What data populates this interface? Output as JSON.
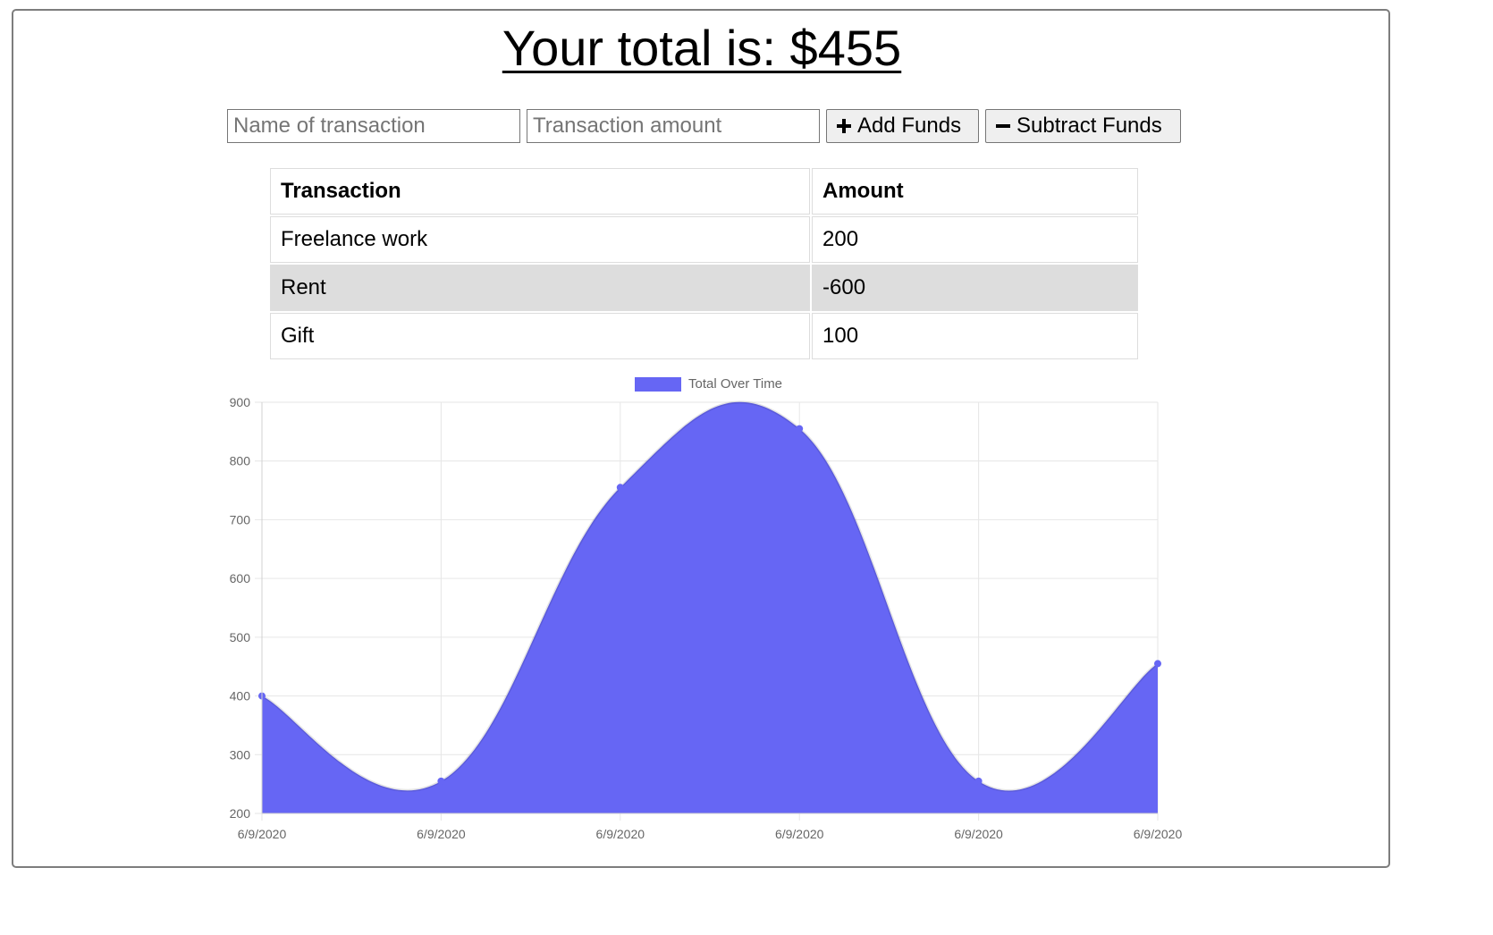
{
  "header": {
    "total_prefix": "Your total is: ",
    "total_value": "$455"
  },
  "form": {
    "name_placeholder": "Name of transaction",
    "amount_placeholder": "Transaction amount",
    "add_label": "Add Funds",
    "subtract_label": "Subtract Funds",
    "add_icon": "plus-icon",
    "subtract_icon": "minus-icon"
  },
  "table": {
    "headers": [
      "Transaction",
      "Amount"
    ],
    "rows": [
      {
        "name": "Freelance work",
        "amount": "200"
      },
      {
        "name": "Rent",
        "amount": "-600"
      },
      {
        "name": "Gift",
        "amount": "100"
      }
    ]
  },
  "chart_data": {
    "type": "area",
    "title": "",
    "xlabel": "",
    "ylabel": "",
    "categories": [
      "6/9/2020",
      "6/9/2020",
      "6/9/2020",
      "6/9/2020",
      "6/9/2020",
      "6/9/2020"
    ],
    "series": [
      {
        "name": "Total Over Time",
        "values": [
          400,
          255,
          755,
          855,
          255,
          455
        ],
        "color": "#6666f4"
      }
    ],
    "ylim": [
      200,
      900
    ],
    "yticks": [
      200,
      300,
      400,
      500,
      600,
      700,
      800,
      900
    ],
    "grid": true,
    "legend": "top"
  }
}
